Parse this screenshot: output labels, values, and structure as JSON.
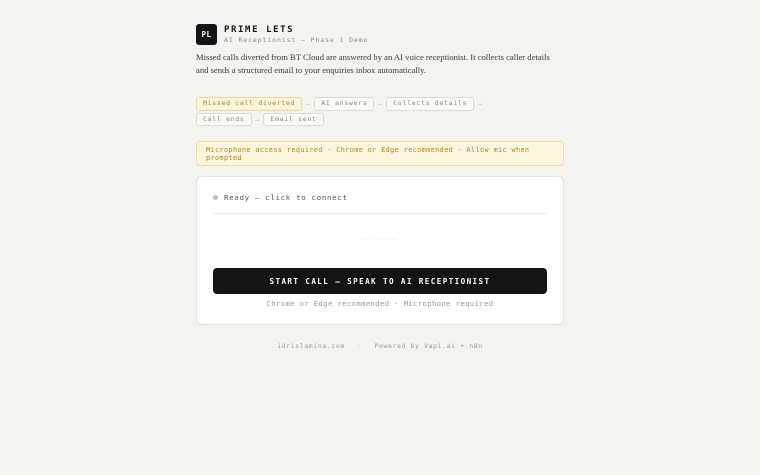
{
  "header": {
    "logo_text": "PL",
    "brand": "PRIME LETS",
    "subtitle": "AI Receptionist — Phase 1 Demo"
  },
  "description": "Missed calls diverted from BT Cloud are answered by an AI voice receptionist. It collects caller details and sends a structured email to your enquiries inbox automatically.",
  "flow": {
    "steps": [
      {
        "label": "Missed call diverted",
        "active": true
      },
      {
        "label": "AI answers",
        "active": false
      },
      {
        "label": "Collects details",
        "active": false
      },
      {
        "label": "Call ends",
        "active": false
      },
      {
        "label": "Email sent",
        "active": false
      }
    ],
    "separator": "→"
  },
  "notice": "Microphone access required · Chrome or Edge recommended · Allow mic when prompted",
  "call_panel": {
    "status": "Ready — click to connect",
    "transcript_placeholder": "··········",
    "button_label": "START CALL — SPEAK TO AI RECEPTIONIST",
    "hint": "Chrome or Edge recommended · Microphone required"
  },
  "footer": {
    "site": "idrislamina.com",
    "separator": "·",
    "powered": "Powered by Vapi.ai + n8n"
  },
  "colors": {
    "background": "#f4f3f0",
    "button": "#141414",
    "accent_amber": "#b88a1c",
    "notice_bg": "#fcf6df"
  }
}
